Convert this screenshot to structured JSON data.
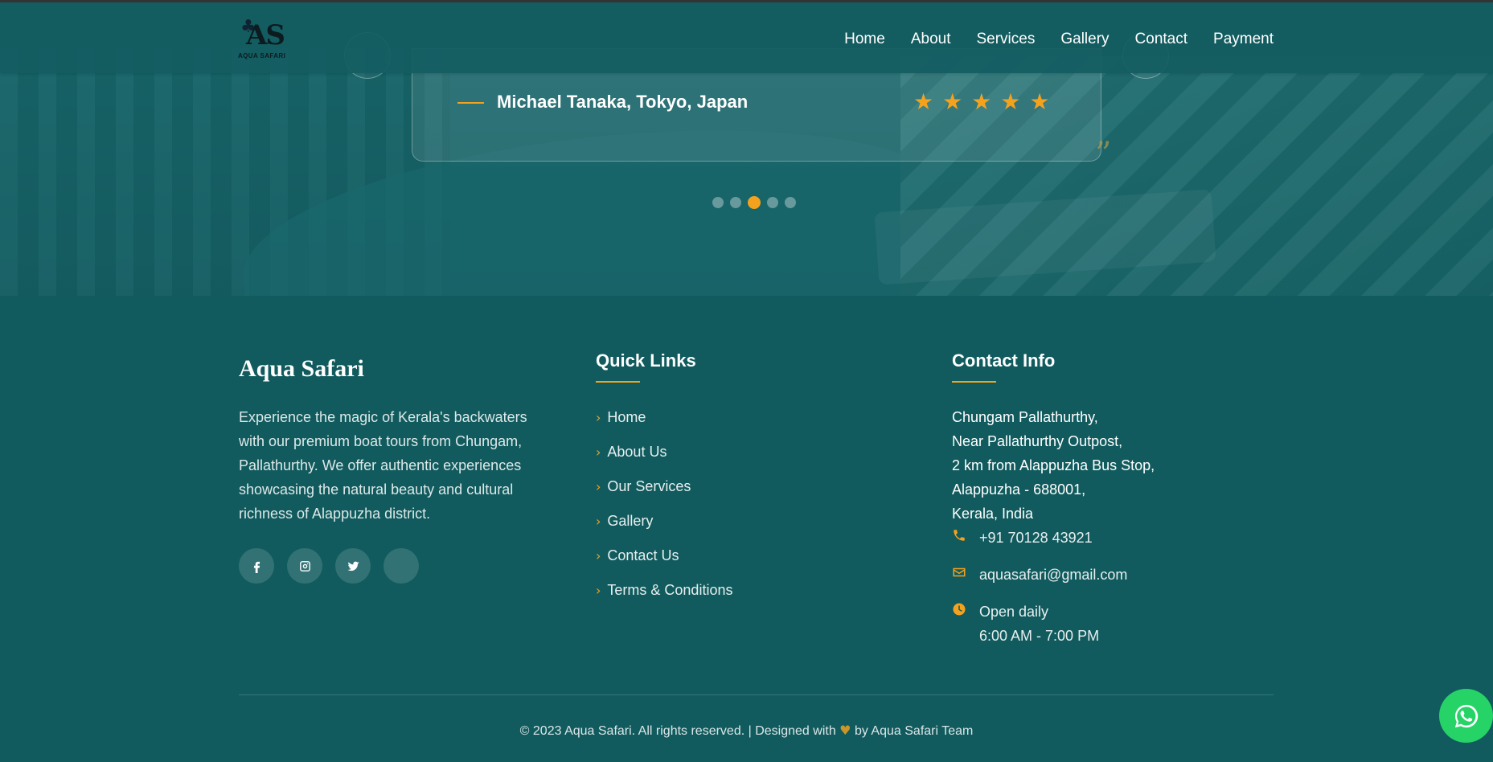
{
  "header": {
    "logo": {
      "mark": "AS",
      "text": "AQUA SAFARI"
    },
    "nav": [
      "Home",
      "About",
      "Services",
      "Gallery",
      "Contact",
      "Payment"
    ]
  },
  "testimonial": {
    "author": "Michael Tanaka, Tokyo, Japan",
    "rating": 5,
    "rating_max": 5,
    "quote_mark": "”",
    "slides_total": 5,
    "active_slide": 3
  },
  "footer": {
    "brand": "Aqua Safari",
    "about": "Experience the magic of Kerala's backwaters with our premium boat tours from Chungam, Pallathurthy. We offer authentic experiences showcasing the natural beauty and cultural richness of Alappuzha district.",
    "socials": [
      "facebook-icon",
      "instagram-icon",
      "twitter-icon",
      "blank-icon"
    ],
    "quick_links": {
      "title": "Quick Links",
      "items": [
        "Home",
        "About Us",
        "Our Services",
        "Gallery",
        "Contact Us",
        "Terms & Conditions"
      ]
    },
    "contact": {
      "title": "Contact Info",
      "address": [
        "Chungam Pallathurthy,",
        "Near Pallathurthy Outpost,",
        "2 km from Alappuzha Bus Stop,",
        "Alappuzha - 688001,",
        "Kerala, India"
      ],
      "phone": "+91 70128 43921",
      "email": "aquasafari@gmail.com",
      "hours_label": "Open daily",
      "hours": "6:00 AM - 7:00 PM"
    },
    "copyright": {
      "before": "© 2023 Aqua Safari. All rights reserved. | Designed with",
      "after": "by Aqua Safari Team"
    }
  },
  "colors": {
    "accent": "#f4a21d",
    "footer_bg": "#115b5e",
    "whatsapp": "#25d366"
  }
}
